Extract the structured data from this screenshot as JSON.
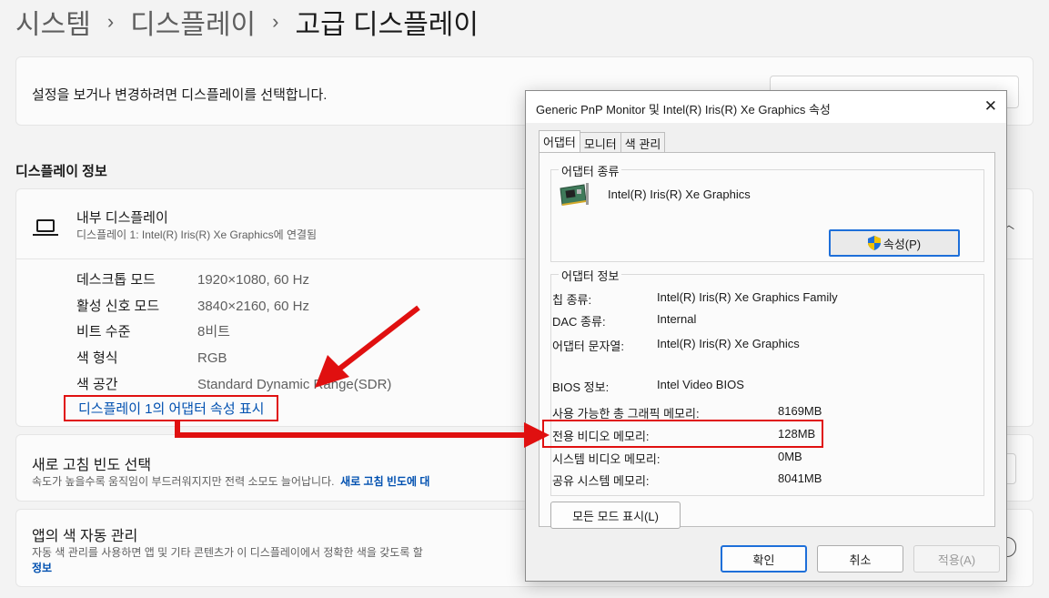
{
  "breadcrumb": {
    "system": "시스템",
    "display": "디스플레이",
    "current": "고급 디스플레이",
    "separator": "›"
  },
  "select_display": {
    "text": "설정을 보거나 변경하려면 디스플레이를 선택합니다."
  },
  "display_info": {
    "section_title": "디스플레이 정보",
    "name": "내부 디스플레이",
    "sub": "디스플레이 1: Intel(R) Iris(R) Xe Graphics에 연결됨",
    "rows": [
      {
        "key": "데스크톱 모드",
        "value": "1920×1080, 60 Hz"
      },
      {
        "key": "활성 신호 모드",
        "value": "3840×2160, 60 Hz"
      },
      {
        "key": "비트 수준",
        "value": "8비트"
      },
      {
        "key": "색 형식",
        "value": "RGB"
      },
      {
        "key": "색 공간",
        "value": "Standard Dynamic Range(SDR)"
      }
    ],
    "adapter_link": "디스플레이 1의 어댑터 속성 표시"
  },
  "refresh": {
    "title": "새로 고침 빈도 선택",
    "sub": "속도가 높을수록 움직임이 부드러워지지만 전력 소모도 늘어납니다.",
    "link": "새로 고침 빈도에 대"
  },
  "color_mgmt": {
    "title": "앱의 색 자동 관리",
    "sub": "자동 색 관리를 사용하면 앱 및 기타 콘텐츠가 이 디스플레이에서 정확한 색을 갖도록 할",
    "link": "정보"
  },
  "dialog": {
    "title": "Generic PnP Monitor 및 Intel(R) Iris(R) Xe Graphics 속성",
    "close": "✕",
    "tabs": [
      "어댑터",
      "모니터",
      "색 관리"
    ],
    "adapter_type_label": "어댑터 종류",
    "adapter_name": "Intel(R) Iris(R) Xe Graphics",
    "properties_button": "속성(P)",
    "adapter_info_label": "어댑터 정보",
    "info": [
      {
        "key": "칩 종류:",
        "value": "Intel(R) Iris(R) Xe Graphics Family"
      },
      {
        "key": "DAC 종류:",
        "value": "Internal"
      },
      {
        "key": "어댑터 문자열:",
        "value": "Intel(R) Iris(R) Xe Graphics"
      },
      {
        "key": "BIOS 정보:",
        "value": "Intel Video BIOS"
      }
    ],
    "memory": [
      {
        "key": "사용 가능한 총 그래픽 메모리:",
        "value": "8169MB"
      },
      {
        "key": "전용 비디오 메모리:",
        "value": "128MB"
      },
      {
        "key": "시스템 비디오 메모리:",
        "value": "0MB"
      },
      {
        "key": "공유 시스템 메모리:",
        "value": "8041MB"
      }
    ],
    "all_modes_button": "모든 모드 표시(L)",
    "ok_button": "확인",
    "cancel_button": "취소",
    "apply_button": "적용(A)"
  },
  "colors": {
    "annotation_red": "#e01010",
    "link_blue": "#0050b0",
    "focus_blue": "#1e6fd9"
  }
}
